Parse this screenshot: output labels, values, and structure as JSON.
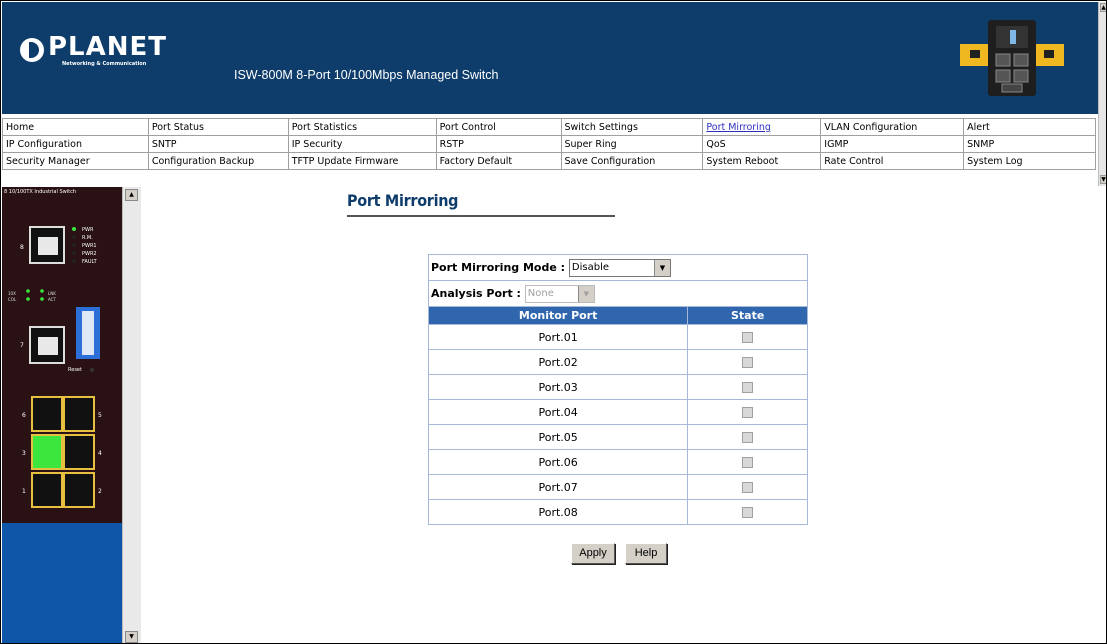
{
  "header": {
    "logo_text": "PLANET",
    "logo_subtext": "Networking & Communication",
    "product_title": "ISW-800M 8-Port 10/100Mbps Managed Switch"
  },
  "nav": {
    "rows": [
      [
        "Home",
        "Port Status",
        "Port Statistics",
        "Port Control",
        "Switch Settings",
        "Port Mirroring",
        "VLAN Configuration",
        "Alert"
      ],
      [
        "IP Configuration",
        "SNTP",
        "IP Security",
        "RSTP",
        "Super Ring",
        "QoS",
        "IGMP",
        "SNMP"
      ],
      [
        "Security Manager",
        "Configuration Backup",
        "TFTP Update Firmware",
        "Factory Default",
        "Save Configuration",
        "System Reboot",
        "Rate Control",
        "System Log"
      ]
    ],
    "selected": "Port Mirroring"
  },
  "left_panel": {
    "label": "8 10/100TX Industrial Switch",
    "led_labels": [
      "PWR",
      "R.M.",
      "PWR1",
      "PWR2",
      "FAULT"
    ],
    "reset_label": "Reset"
  },
  "main": {
    "title": "Port Mirroring",
    "mode_label": "Port Mirroring Mode :",
    "mode_value": "Disable",
    "analysis_label": "Analysis Port :",
    "analysis_value": "None",
    "col_monitor": "Monitor Port",
    "col_state": "State",
    "ports": [
      {
        "name": "Port.01",
        "checked": false
      },
      {
        "name": "Port.02",
        "checked": false
      },
      {
        "name": "Port.03",
        "checked": false
      },
      {
        "name": "Port.04",
        "checked": false
      },
      {
        "name": "Port.05",
        "checked": false
      },
      {
        "name": "Port.06",
        "checked": false
      },
      {
        "name": "Port.07",
        "checked": false
      },
      {
        "name": "Port.08",
        "checked": false
      }
    ],
    "apply_label": "Apply",
    "help_label": "Help"
  },
  "colors": {
    "header_bg": "#0f3d6b",
    "table_header_bg": "#2f66ad",
    "left_panel_bg": "#0f56a8",
    "device_bg": "#2a1214"
  }
}
